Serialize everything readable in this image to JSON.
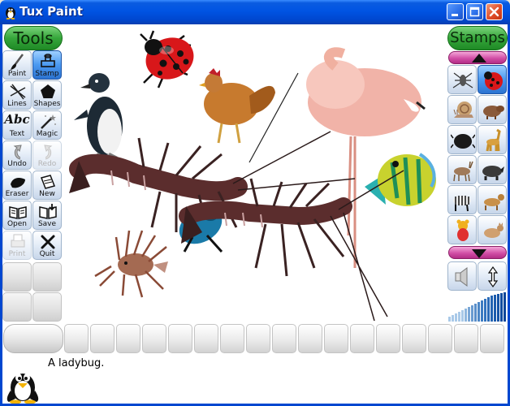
{
  "window": {
    "title": "Tux Paint",
    "buttons": [
      "minimize",
      "maximize",
      "close"
    ]
  },
  "tools": {
    "title": "Tools",
    "items": [
      {
        "label": "Paint",
        "icon": "paintbrush-icon",
        "state": "normal"
      },
      {
        "label": "Stamp",
        "icon": "stamp-icon",
        "state": "selected"
      },
      {
        "label": "Lines",
        "icon": "lines-icon",
        "state": "normal"
      },
      {
        "label": "Shapes",
        "icon": "pentagon-icon",
        "state": "normal"
      },
      {
        "label": "Text",
        "icon": "abc-text-icon",
        "glyph": "Abc",
        "state": "normal"
      },
      {
        "label": "Magic",
        "icon": "magic-wand-icon",
        "state": "normal"
      },
      {
        "label": "Undo",
        "icon": "undo-icon",
        "state": "normal"
      },
      {
        "label": "Redo",
        "icon": "redo-icon",
        "state": "disabled"
      },
      {
        "label": "Eraser",
        "icon": "eraser-icon",
        "state": "normal"
      },
      {
        "label": "New",
        "icon": "new-document-icon",
        "state": "normal"
      },
      {
        "label": "Open",
        "icon": "open-book-icon",
        "state": "normal"
      },
      {
        "label": "Save",
        "icon": "save-icon",
        "state": "normal"
      },
      {
        "label": "Print",
        "icon": "printer-icon",
        "state": "disabled"
      },
      {
        "label": "Quit",
        "icon": "quit-x-icon",
        "state": "normal"
      }
    ]
  },
  "stamps": {
    "title": "Stamps",
    "items": [
      {
        "icon": "mosquito-icon",
        "selected": false
      },
      {
        "icon": "ladybug-icon",
        "selected": true
      },
      {
        "icon": "snail-icon",
        "selected": false
      },
      {
        "icon": "capybara-icon",
        "selected": false
      },
      {
        "icon": "beetle-icon",
        "selected": false
      },
      {
        "icon": "giraffe-icon",
        "selected": false
      },
      {
        "icon": "antelope-icon",
        "selected": false
      },
      {
        "icon": "rhino-icon",
        "selected": false
      },
      {
        "icon": "zebra-icon",
        "selected": false
      },
      {
        "icon": "dog-icon",
        "selected": false
      },
      {
        "icon": "teddy-bear-icon",
        "selected": false
      },
      {
        "icon": "cat-icon",
        "selected": false
      }
    ],
    "controls": [
      "scroll-up",
      "scroll-down",
      "mirror-toggle",
      "flip-toggle",
      "size-slider"
    ]
  },
  "canvas": {
    "stamps": [
      "penguin",
      "ladybug",
      "hen",
      "flamingo",
      "lobster",
      "lobster",
      "tropical-fish",
      "lionfish",
      "blue-beetle"
    ]
  },
  "colors": {
    "selected": "#ffffff",
    "slot_count": 17
  },
  "info": {
    "message": "A ladybug."
  },
  "theme": {
    "accent_green": "#2e9b33",
    "selection_blue": "#3c86e6",
    "scroll_magenta": "#c43c98",
    "titlebar_blue": "#0054e3"
  }
}
